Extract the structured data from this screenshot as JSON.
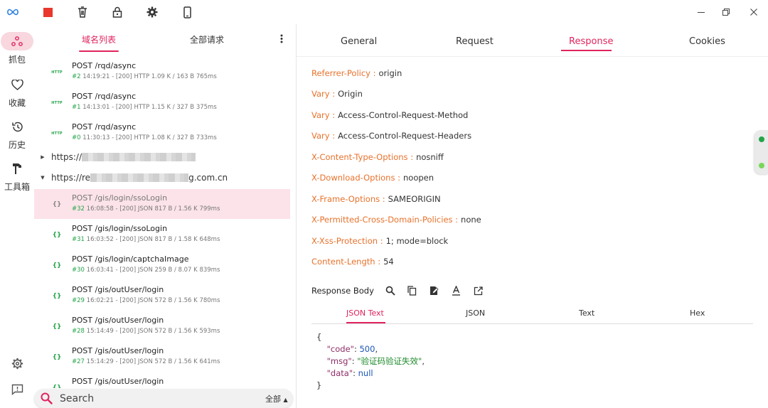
{
  "toolbar": {
    "icons": [
      "infinity-icon",
      "stop-icon",
      "trash-icon",
      "lock-icon",
      "gear-icon",
      "phone-icon"
    ],
    "colors": {
      "accent": "#e0245e",
      "stop": "#e8372c",
      "infinity": "#2a7fe0"
    }
  },
  "window": {
    "icons": [
      "minimize-icon",
      "maximize-icon",
      "close-icon"
    ]
  },
  "nav": {
    "items": [
      {
        "label": "抓包",
        "icon": "capture-icon",
        "active": true
      },
      {
        "label": "收藏",
        "icon": "heart-icon"
      },
      {
        "label": "历史",
        "icon": "history-icon"
      },
      {
        "label": "工具箱",
        "icon": "toolbox-icon"
      }
    ],
    "bottom": [
      "settings-icon",
      "feedback-icon"
    ]
  },
  "list": {
    "tabs": [
      "域名列表",
      "全部请求"
    ],
    "requests_top": [
      {
        "icon": "HTTP",
        "title": "POST /rqd/async",
        "num": "#2",
        "meta": " 14:19:21 - [200]  HTTP 1.09 K / 163 B  765ms"
      },
      {
        "icon": "HTTP",
        "title": "POST /rqd/async",
        "num": "#1",
        "meta": " 14:13:01 - [200]  HTTP 1.15 K / 327 B  375ms"
      },
      {
        "icon": "HTTP",
        "title": "POST /rqd/async",
        "num": "#0",
        "meta": " 11:30:13 - [200]  HTTP 1.08 K / 327 B  733ms"
      }
    ],
    "hosts": [
      {
        "prefix": "https://",
        "suffix": ""
      },
      {
        "prefix": "https://re",
        "suffix": "g.com.cn"
      }
    ],
    "requests": [
      {
        "icon": "{}",
        "title": "POST /gis/login/ssoLogin",
        "num": "#32",
        "meta": " 16:08:58 - [200]  JSON 817 B / 1.56 K  799ms",
        "selected": true
      },
      {
        "icon": "{}",
        "title": "POST /gis/login/ssoLogin",
        "num": "#31",
        "meta": " 16:03:52 - [200]  JSON 817 B / 1.58 K  648ms"
      },
      {
        "icon": "{}",
        "title": "POST /gis/login/captchaImage",
        "num": "#30",
        "meta": " 16:03:41 - [200]  JSON 259 B / 8.07 K  839ms"
      },
      {
        "icon": "{}",
        "title": "POST /gis/outUser/login",
        "num": "#29",
        "meta": " 16:02:21 - [200]  JSON 572 B / 1.56 K  780ms"
      },
      {
        "icon": "{}",
        "title": "POST /gis/outUser/login",
        "num": "#28",
        "meta": " 15:14:49 - [200]  JSON 572 B / 1.56 K  593ms"
      },
      {
        "icon": "{}",
        "title": "POST /gis/outUser/login",
        "num": "#27",
        "meta": " 15:14:29 - [200]  JSON 572 B / 1.56 K  641ms"
      },
      {
        "icon": "{}",
        "title": "POST /gis/outUser/login",
        "num": "",
        "meta": ""
      }
    ],
    "search": {
      "placeholder": "Search",
      "filter": "全部"
    }
  },
  "detail": {
    "tabs": [
      "General",
      "Request",
      "Response",
      "Cookies"
    ],
    "active_tab": "Response",
    "headers": [
      {
        "key": "Referrer-Policy :",
        "value": "origin"
      },
      {
        "key": "Vary :",
        "value": "Origin"
      },
      {
        "key": "Vary :",
        "value": "Access-Control-Request-Method"
      },
      {
        "key": "Vary :",
        "value": "Access-Control-Request-Headers"
      },
      {
        "key": "X-Content-Type-Options :",
        "value": "nosniff"
      },
      {
        "key": "X-Download-Options :",
        "value": "noopen"
      },
      {
        "key": "X-Frame-Options :",
        "value": "SAMEORIGIN"
      },
      {
        "key": "X-Permitted-Cross-Domain-Policies :",
        "value": "none"
      },
      {
        "key": "X-Xss-Protection :",
        "value": "1; mode=block"
      },
      {
        "key": "Content-Length :",
        "value": "54"
      }
    ],
    "response_body": {
      "label": "Response Body",
      "tools": [
        "search-icon",
        "copy-icon",
        "edit-icon",
        "font-icon",
        "open-external-icon"
      ],
      "tabs": [
        "JSON Text",
        "JSON",
        "Text",
        "Hex"
      ],
      "json": {
        "open": "{",
        "lines": [
          {
            "key": "\"code\"",
            "value": "500",
            "type": "num",
            "comma": ","
          },
          {
            "key": "\"msg\"",
            "value": "\"验证码验证失效\"",
            "type": "str",
            "comma": ","
          },
          {
            "key": "\"data\"",
            "value": "null",
            "type": "null",
            "comma": ""
          }
        ],
        "close": "}"
      }
    }
  }
}
